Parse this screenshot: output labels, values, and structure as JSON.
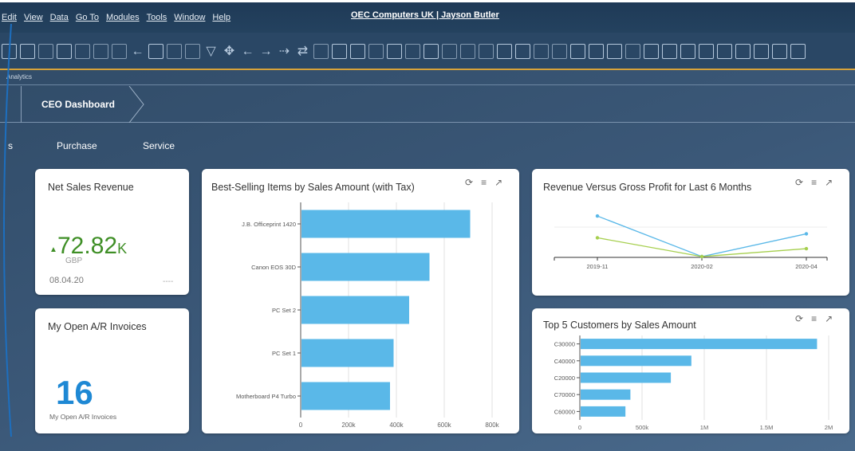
{
  "menubar": {
    "items": [
      "Edit",
      "View",
      "Data",
      "Go To",
      "Modules",
      "Tools",
      "Window",
      "Help"
    ],
    "window_title": "OEC Computers UK | Jayson Butler"
  },
  "app": {
    "name": "Analytics"
  },
  "breadcrumb": {
    "current": "CEO Dashboard"
  },
  "tabs": {
    "partial": "s",
    "purchase": "Purchase",
    "service": "Service"
  },
  "colors": {
    "accent": "#5ab8e8",
    "kpi_green": "#3f8f26",
    "kpi_blue": "#1e88d4",
    "line_blue": "#5ab8e8",
    "line_green": "#a6cf4e",
    "gold": "#d6a23a"
  },
  "cards": {
    "net_sales": {
      "title": "Net Sales Revenue",
      "value": "72.82",
      "unit": "K",
      "currency": "GBP",
      "date": "08.04.20",
      "dash": "----"
    },
    "open_ar": {
      "title": "My Open A/R Invoices",
      "value": "16",
      "subtitle": "My Open A/R Invoices"
    },
    "best_selling": {
      "title": "Best-Selling Items by Sales Amount (with Tax)"
    },
    "revenue_vs_gp": {
      "title": "Revenue Versus Gross Profit for Last 6 Months"
    },
    "top_customers": {
      "title": "Top 5 Customers by Sales Amount"
    },
    "icons": [
      "refresh-icon",
      "list-icon",
      "expand-icon"
    ]
  },
  "chart_data": [
    {
      "type": "bar",
      "orientation": "horizontal",
      "title": "Best-Selling Items by Sales Amount (with Tax)",
      "categories": [
        "J.B. Officeprint 1420",
        "Canon EOS 30D",
        "PC Set 2",
        "PC Set 1",
        "Motherboard P4 Turbo"
      ],
      "values": [
        705000,
        535000,
        450000,
        385000,
        370000
      ],
      "x_ticks": [
        "0",
        "200k",
        "400k",
        "600k",
        "800k"
      ],
      "xlim": [
        0,
        800000
      ],
      "grid": true
    },
    {
      "type": "line",
      "title": "Revenue Versus Gross Profit for Last 6 Months",
      "x": [
        "2019-11",
        "2020-02",
        "2020-04"
      ],
      "series": [
        {
          "values": [
            0.82,
            0,
            0.46
          ]
        },
        {
          "values": [
            0.38,
            0,
            0.16
          ]
        }
      ]
    },
    {
      "type": "bar",
      "orientation": "horizontal",
      "title": "Top 5 Customers by Sales Amount",
      "categories": [
        "C30000",
        "C40000",
        "C20000",
        "C70000",
        "C60000"
      ],
      "values": [
        1900000,
        890000,
        725000,
        400000,
        360000
      ],
      "x_ticks": [
        "0",
        "500k",
        "1M",
        "1.5M",
        "2M"
      ],
      "xlim": [
        0,
        2000000
      ],
      "grid": true
    }
  ]
}
